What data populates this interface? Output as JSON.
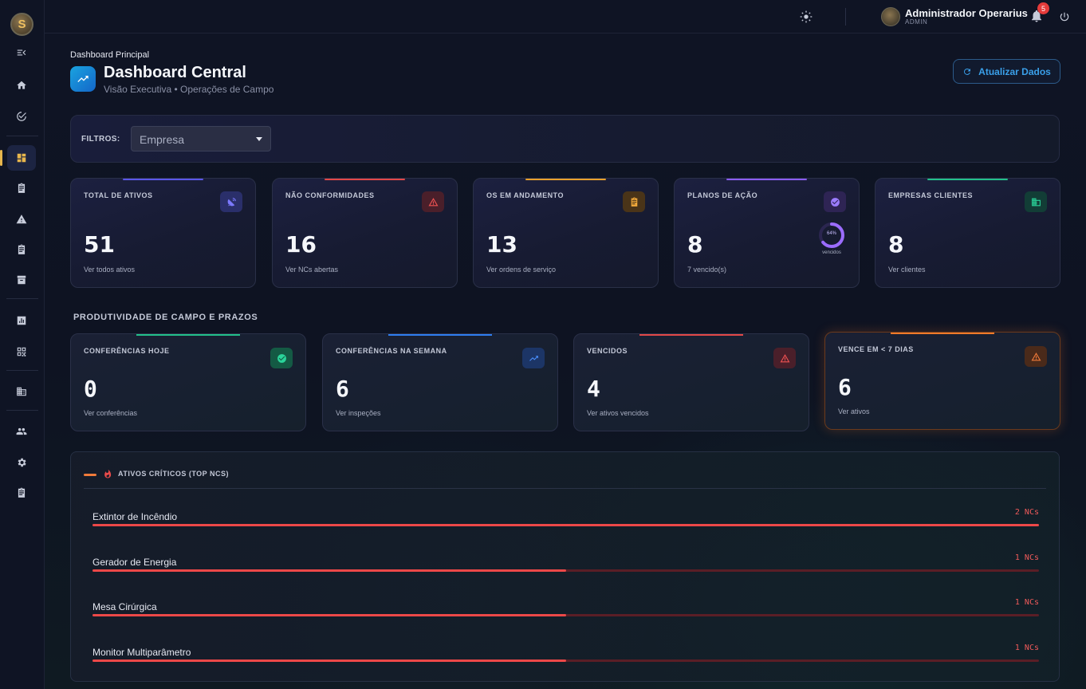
{
  "topbar": {
    "user_name": "Administrador Operarius",
    "user_role": "ADMIN",
    "notification_count": "5"
  },
  "header": {
    "breadcrumb": "Dashboard Principal",
    "title": "Dashboard Central",
    "subtitle": "Visão Executiva • Operações de Campo",
    "refresh_label": "Atualizar Dados"
  },
  "filters": {
    "label": "FILTROS:",
    "company_placeholder": "Empresa"
  },
  "stats": [
    {
      "label": "TOTAL DE ATIVOS",
      "value": "51",
      "link": "Ver todos ativos",
      "accent": "#5b57e8",
      "icon": "satellite-dish-icon",
      "icon_bg": "#2a2f6a",
      "icon_color": "#7b79ff"
    },
    {
      "label": "NÃO CONFORMIDADES",
      "value": "16",
      "link": "Ver NCs abertas",
      "accent": "#e24848",
      "icon": "warning-icon",
      "icon_bg": "#4a1f2a",
      "icon_color": "#f05252"
    },
    {
      "label": "OS EM ANDAMENTO",
      "value": "13",
      "link": "Ver ordens de serviço",
      "accent": "#e8a02c",
      "icon": "clipboard-icon",
      "icon_bg": "#4a3418",
      "icon_color": "#f2a93a"
    },
    {
      "label": "PLANOS DE AÇÃO",
      "value": "8",
      "link": "7 vencido(s)",
      "accent": "#8b5cf6",
      "icon": "check-circle-icon",
      "icon_bg": "#2e2454",
      "icon_color": "#9b7cff"
    },
    {
      "label": "EMPRESAS CLIENTES",
      "value": "8",
      "link": "Ver clientes",
      "accent": "#22c08a",
      "icon": "building-icon",
      "icon_bg": "#123d36",
      "icon_color": "#2ad49a"
    }
  ],
  "action_plans_progress": {
    "percent_label": "64%",
    "caption": "vencidos",
    "fraction": 0.64
  },
  "productivity": {
    "title": "PRODUTIVIDADE DE CAMPO E PRAZOS",
    "cards": [
      {
        "label": "CONFERÊNCIAS HOJE",
        "value": "0",
        "link": "Ver conferências",
        "accent": "#22c08a",
        "icon": "check-circle-icon",
        "icon_bg": "#145a44",
        "icon_color": "#2ad49a"
      },
      {
        "label": "CONFERÊNCIAS NA SEMANA",
        "value": "6",
        "link": "Ver inspeções",
        "accent": "#2f7df0",
        "icon": "trending-up-icon",
        "icon_bg": "#1c3566",
        "icon_color": "#4a90ff"
      },
      {
        "label": "VENCIDOS",
        "value": "4",
        "link": "Ver ativos vencidos",
        "accent": "#e24848",
        "icon": "warning-icon",
        "icon_bg": "#4a1f2a",
        "icon_color": "#f05252"
      },
      {
        "label": "VENCE EM < 7 DIAS",
        "value": "6",
        "link": "Ver ativos",
        "accent": "#f07a2a",
        "icon": "warning-icon",
        "icon_bg": "#4a2a1a",
        "icon_color": "#f07a3a"
      }
    ]
  },
  "critical": {
    "title": "ATIVOS CRÍTICOS (TOP NCS)",
    "items": [
      {
        "name": "Extintor de Incêndio",
        "count": "2 NCs",
        "fraction": 1.0
      },
      {
        "name": "Gerador de Energia",
        "count": "1 NCs",
        "fraction": 0.5
      },
      {
        "name": "Mesa Cirúrgica",
        "count": "1 NCs",
        "fraction": 0.5
      },
      {
        "name": "Monitor Multiparâmetro",
        "count": "1 NCs",
        "fraction": 0.5
      }
    ]
  }
}
